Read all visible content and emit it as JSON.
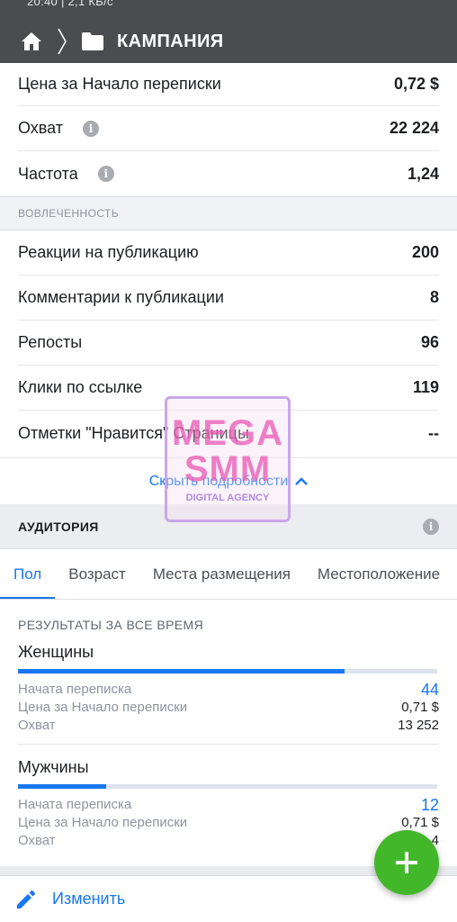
{
  "status_bar": {
    "clipped_text": "20:40 | 2,1 КБ/с"
  },
  "header": {
    "title": "КАМПАНИЯ",
    "home_icon": "home-icon",
    "chevron_icon": "chevron-right-icon",
    "folder_icon": "folder-icon"
  },
  "top_rows": [
    {
      "label": "Цена за Начало переписки",
      "value": "0,72 $",
      "info": false
    },
    {
      "label": "Охват",
      "value": "22 224",
      "info": true
    },
    {
      "label": "Частота",
      "value": "1,24",
      "info": true
    }
  ],
  "engagement": {
    "section_label": "ВОВЛЕЧЕННОСТЬ",
    "rows": [
      {
        "label": "Реакции на публикацию",
        "value": "200"
      },
      {
        "label": "Комментарии к публикации",
        "value": "8"
      },
      {
        "label": "Репосты",
        "value": "96"
      },
      {
        "label": "Клики по ссылке",
        "value": "119"
      },
      {
        "label": "Отметки \"Нравится\" Страницы",
        "value": "--"
      }
    ],
    "hide_details": "Скрыть подробности"
  },
  "audience": {
    "title": "АУДИТОРИЯ",
    "tabs": [
      "Пол",
      "Возраст",
      "Места размещения",
      "Местоположение"
    ],
    "active_tab": 0,
    "results_header": "РЕЗУЛЬТАТЫ ЗА ВСЕ ВРЕМЯ",
    "groups": [
      {
        "name": "Женщины",
        "bar_fraction": 0.78,
        "metrics": [
          {
            "label": "Начата переписка",
            "value": "44"
          },
          {
            "label": "Цена за Начало переписки",
            "value": "0,71 $"
          },
          {
            "label": "Охват",
            "value": "13 252"
          }
        ]
      },
      {
        "name": "Мужчины",
        "bar_fraction": 0.21,
        "metrics": [
          {
            "label": "Начата переписка",
            "value": "12"
          },
          {
            "label": "Цена за Начало переписки",
            "value": "0,71 $"
          },
          {
            "label": "Охват",
            "value": "...4"
          }
        ]
      }
    ]
  },
  "bottom_action": {
    "label": "Изменить",
    "icon": "pencil-icon"
  },
  "fab": {
    "icon": "plus-icon",
    "color": "#42b72a"
  },
  "watermark": {
    "line1": "MEGA",
    "line2": "SMM",
    "line3": "DIGITAL AGENCY"
  },
  "colors": {
    "header_bg": "#4b4c4f",
    "accent": "#1877f2"
  }
}
